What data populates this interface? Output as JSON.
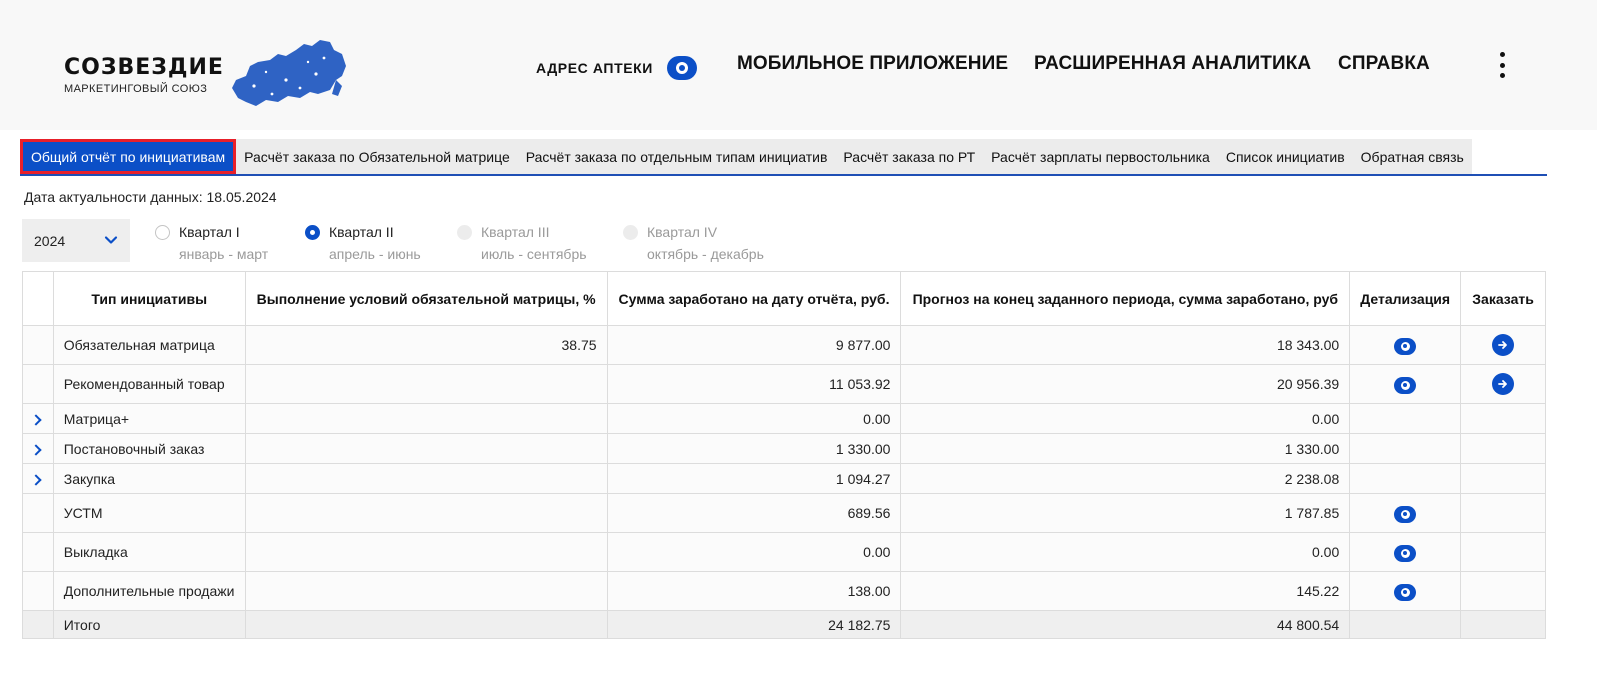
{
  "header": {
    "logo_title": "СОЗВЕЗДИЕ",
    "logo_subtitle": "МАРКЕТИНГОВЫЙ СОЮЗ",
    "address_label": "АДРЕС АПТЕКИ",
    "nav": {
      "mobile_app": "МОБИЛЬНОЕ ПРИЛОЖЕНИЕ",
      "analytics": "РАСШИРЕННАЯ АНАЛИТИКА",
      "help": "СПРАВКА"
    },
    "accent_color": "#0b4fc7"
  },
  "tabs": [
    {
      "label": "Общий отчёт по инициативам",
      "active": true
    },
    {
      "label": "Расчёт заказа по Обязательной матрице",
      "active": false
    },
    {
      "label": "Расчёт заказа по отдельным типам инициатив",
      "active": false
    },
    {
      "label": "Расчёт заказа по РТ",
      "active": false
    },
    {
      "label": "Расчёт зарплаты первостольника",
      "active": false
    },
    {
      "label": "Список инициатив",
      "active": false
    },
    {
      "label": "Обратная связь",
      "active": false
    }
  ],
  "data_date": "Дата актуальности данных: 18.05.2024",
  "year_select": {
    "value": "2024"
  },
  "quarters": [
    {
      "label": "Квартал I",
      "months": "январь - март",
      "state": "unchecked"
    },
    {
      "label": "Квартал II",
      "months": "апрель - июнь",
      "state": "checked"
    },
    {
      "label": "Квартал III",
      "months": "июль - сентябрь",
      "state": "disabled"
    },
    {
      "label": "Квартал IV",
      "months": "октябрь - декабрь",
      "state": "disabled"
    }
  ],
  "table": {
    "headers": {
      "type": "Тип инициативы",
      "matrix": "Выполнение условий обязательной матрицы, %",
      "earned": "Сумма заработано на дату отчёта, руб.",
      "forecast": "Прогноз на конец заданного периода, сумма заработано, руб",
      "details": "Детализация",
      "order": "Заказать"
    },
    "rows": [
      {
        "name": "Обязательная матрица",
        "matrix": "38.75",
        "earned": "9 877.00",
        "forecast": "18 343.00",
        "expandable": false,
        "details": true,
        "order": true
      },
      {
        "name": "Рекомендованный товар",
        "matrix": "",
        "earned": "11 053.92",
        "forecast": "20 956.39",
        "expandable": false,
        "details": true,
        "order": true
      },
      {
        "name": "Матрица+",
        "matrix": "",
        "earned": "0.00",
        "forecast": "0.00",
        "expandable": true,
        "details": false,
        "order": false
      },
      {
        "name": "Постановочный заказ",
        "matrix": "",
        "earned": "1 330.00",
        "forecast": "1 330.00",
        "expandable": true,
        "details": false,
        "order": false
      },
      {
        "name": "Закупка",
        "matrix": "",
        "earned": "1 094.27",
        "forecast": "2 238.08",
        "expandable": true,
        "details": false,
        "order": false
      },
      {
        "name": "УСТМ",
        "matrix": "",
        "earned": "689.56",
        "forecast": "1 787.85",
        "expandable": false,
        "details": true,
        "order": false
      },
      {
        "name": "Выкладка",
        "matrix": "",
        "earned": "0.00",
        "forecast": "0.00",
        "expandable": false,
        "details": true,
        "order": false
      },
      {
        "name": "Дополнительные продажи",
        "matrix": "",
        "earned": "138.00",
        "forecast": "145.22",
        "expandable": false,
        "details": true,
        "order": false
      }
    ],
    "total": {
      "name": "Итого",
      "earned": "24 182.75",
      "forecast": "44 800.54"
    }
  }
}
